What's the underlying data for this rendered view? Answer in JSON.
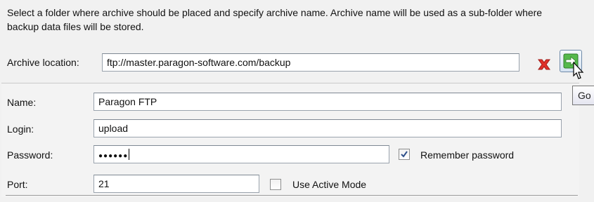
{
  "description": "Select a folder where archive should be placed and specify archive name. Archive name will be used as a sub-folder where backup data files will be stored.",
  "archive_location": {
    "label": "Archive location:",
    "value": "ftp://master.paragon-software.com/backup",
    "clear_icon": "red-x-icon",
    "go_icon": "green-arrow-right-icon",
    "tooltip": "Go"
  },
  "form": {
    "name": {
      "label": "Name:",
      "value": "Paragon FTP"
    },
    "login": {
      "label": "Login:",
      "value": "upload"
    },
    "password": {
      "label": "Password:",
      "value": "●●●●●●"
    },
    "remember_password": {
      "label": "Remember password",
      "checked": true
    },
    "port": {
      "label": "Port:",
      "value": "21"
    },
    "use_active_mode": {
      "label": "Use Active Mode",
      "checked": false
    }
  },
  "colors": {
    "clear_red": "#e0302a",
    "go_green": "#3fae3a",
    "check_blue": "#2d4f8a"
  }
}
